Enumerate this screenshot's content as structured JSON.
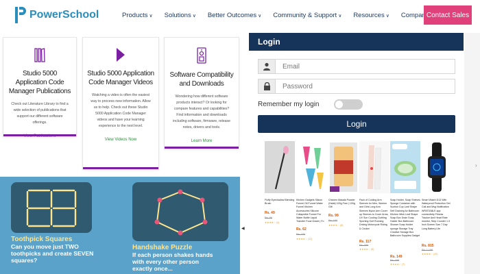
{
  "header": {
    "logo_text": "PowerSchool",
    "nav": [
      {
        "label": "Products",
        "has_dropdown": true
      },
      {
        "label": "Solutions",
        "has_dropdown": true
      },
      {
        "label": "Better Outcomes",
        "has_dropdown": true
      },
      {
        "label": "Community & Support",
        "has_dropdown": true
      },
      {
        "label": "Resources",
        "has_dropdown": true
      },
      {
        "label": "Company",
        "has_dropdown": true
      }
    ],
    "cta_label": "Contact Sales",
    "colors": {
      "brand": "#2a8dbb",
      "nav_text": "#1f3a63",
      "cta": "#e0417b"
    }
  },
  "cards": [
    {
      "icon": "book-stack-icon",
      "title": "Studio 5000 Application Code Manager Publications",
      "description": "Check out Literature Library to find a wide selection of publications that support our different software offerings.",
      "link": "View Publications"
    },
    {
      "icon": "play-icon",
      "title": "Studio 5000 Application Code Manager Videos",
      "description": "Watching a video is often the easiest way to process new information. Allow us to help. Check out these Studio 5000 Application Code Manager videos and have your learning experience to the next level.",
      "link": "View Videos Now"
    },
    {
      "icon": "compatibility-icon",
      "title": "Software Compatibility and Downloads",
      "description": "Wondering how different software products interact? Or looking for compare features and capabilities? Find information and downloads including software, firmware, release notes, drivers and tools.",
      "link": "Learn More"
    }
  ],
  "card_accent": "#7b1fa2",
  "puzzles": [
    {
      "title": "Toothpick Squares",
      "description": "Can you move just TWO toothpicks and create SEVEN squares?"
    },
    {
      "title": "Handshake Puzzle",
      "description": "If each person shakes hands with every other person exactly once..."
    }
  ],
  "login": {
    "heading": "Login",
    "email_placeholder": "Email",
    "password_placeholder": "Password",
    "remember_label": "Remember my login",
    "remember_on": false,
    "button_label": "Login",
    "colors": {
      "primary": "#16345a"
    }
  },
  "shelf": {
    "left_arrow": "◀",
    "products": [
      {
        "name": "Fluffy Eyeshadow Blending Brush",
        "price": "Rs. 49",
        "mrp": "Rs. 99",
        "rating": "★★★★☆ (4)"
      },
      {
        "name": "Kitchen Gadgets Silicon Funnel Oil Funnel Water Funnel Kitchen Accessories Silicone Collapsible Funnel For Water Bottle Liquid Transfer Food Grade | Fo",
        "price": "Rs. 62",
        "mrp": "Rs. 150",
        "rating": "★★★★☆ (12)"
      },
      {
        "name": "Chicken Masala Powder (Halal) 100g Free | 100g Gift",
        "price": "Rs. 99",
        "mrp": "Rs. 150",
        "rating": "★★★★☆ (8)"
      },
      {
        "name": "Pack of Cooling Arm Sleeves for Men, Women and Girls Long Arm Sleeves Nylon Arm Cover up Sleeves to Cover Arms, UV Sun Cooling Clothing Sporting Golf Running Driving Motorcycle Riding & Cricket",
        "price": "Rs. 117",
        "mrp": "Rs. 299",
        "rating": "★★★★☆ (5)"
      },
      {
        "name": "Soap Holder, Soap Shelves Sponge Container with Suction Cup Leaf Shape Self Draining for Bathroom Kitchen Wish Leaf Shape Soap Box Drain Soap Holder Box Bathroom Shower Soap Holder sponge Storage Tray Creative Storage Box Bathroom Supplies Gadget",
        "price": "Rs. 149",
        "mrp": "Rs. 299",
        "rating": "★★★★☆ (7)"
      },
      {
        "name": "Smart Watch D13 With Waterproof Protection Get Call and Msg Notification WRISTABLE app connectivity Fitness Tracker And Heart Rate monitor, Step Counter 1.3 Inch Screen Size 7 Day Long Battery Life",
        "price": "Rs. 815",
        "mrp": "Rs. 1,199",
        "rating": "★★★★☆ (10)"
      }
    ]
  }
}
